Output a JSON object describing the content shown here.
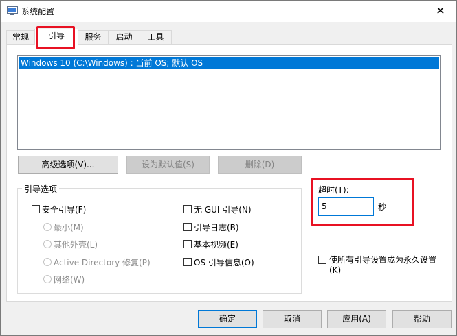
{
  "window": {
    "title": "系统配置",
    "close_glyph": "✕"
  },
  "tabs": [
    {
      "label": "常规",
      "active": false
    },
    {
      "label": "引导",
      "active": true
    },
    {
      "label": "服务",
      "active": false
    },
    {
      "label": "启动",
      "active": false
    },
    {
      "label": "工具",
      "active": false
    }
  ],
  "boot_list": {
    "items": [
      "Windows 10 (C:\\Windows) : 当前 OS; 默认 OS"
    ],
    "selected_index": 0
  },
  "boot_buttons": {
    "advanced": "高级选项(V)...",
    "set_default": "设为默认值(S)",
    "delete": "删除(D)"
  },
  "boot_options": {
    "group_title": "引导选项",
    "safe_boot": {
      "label": "安全引导(F)",
      "checked": false
    },
    "safe_modes": [
      {
        "label": "最小(M)",
        "enabled": false
      },
      {
        "label": "其他外壳(L)",
        "enabled": false
      },
      {
        "label": "Active Directory 修复(P)",
        "enabled": false
      },
      {
        "label": "网络(W)",
        "enabled": false
      }
    ],
    "right_options": [
      {
        "label": "无 GUI 引导(N)",
        "checked": false
      },
      {
        "label": "引导日志(B)",
        "checked": false
      },
      {
        "label": "基本视频(E)",
        "checked": false
      },
      {
        "label": "OS 引导信息(O)",
        "checked": false
      }
    ]
  },
  "timeout": {
    "label": "超时(T):",
    "value": "5",
    "unit": "秒"
  },
  "permanent": {
    "label_line1": "使所有引导设置成为永久设置",
    "label_line2": "(K)",
    "checked": false
  },
  "footer_buttons": {
    "ok": "确定",
    "cancel": "取消",
    "apply": "应用(A)",
    "help": "帮助"
  },
  "colors": {
    "selection": "#0078d7",
    "highlight_annotation": "#e81123"
  }
}
